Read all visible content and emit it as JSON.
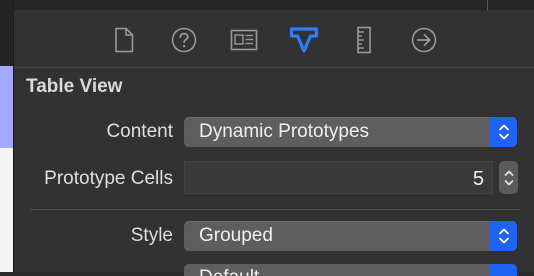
{
  "inspector": {
    "tabs": [
      {
        "icon": "file-icon",
        "active": false
      },
      {
        "icon": "help-icon",
        "active": false
      },
      {
        "icon": "identity-icon",
        "active": false
      },
      {
        "icon": "attributes-icon",
        "active": true
      },
      {
        "icon": "ruler-icon",
        "active": false
      },
      {
        "icon": "connections-icon",
        "active": false
      }
    ],
    "accent_color": "#1f63f3"
  },
  "table_view": {
    "section_title": "Table View",
    "content": {
      "label": "Content",
      "value": "Dynamic Prototypes"
    },
    "prototype_cells": {
      "label": "Prototype Cells",
      "value": "5"
    },
    "style": {
      "label": "Style",
      "value": "Grouped"
    },
    "next_popup": {
      "value": "Default"
    }
  }
}
